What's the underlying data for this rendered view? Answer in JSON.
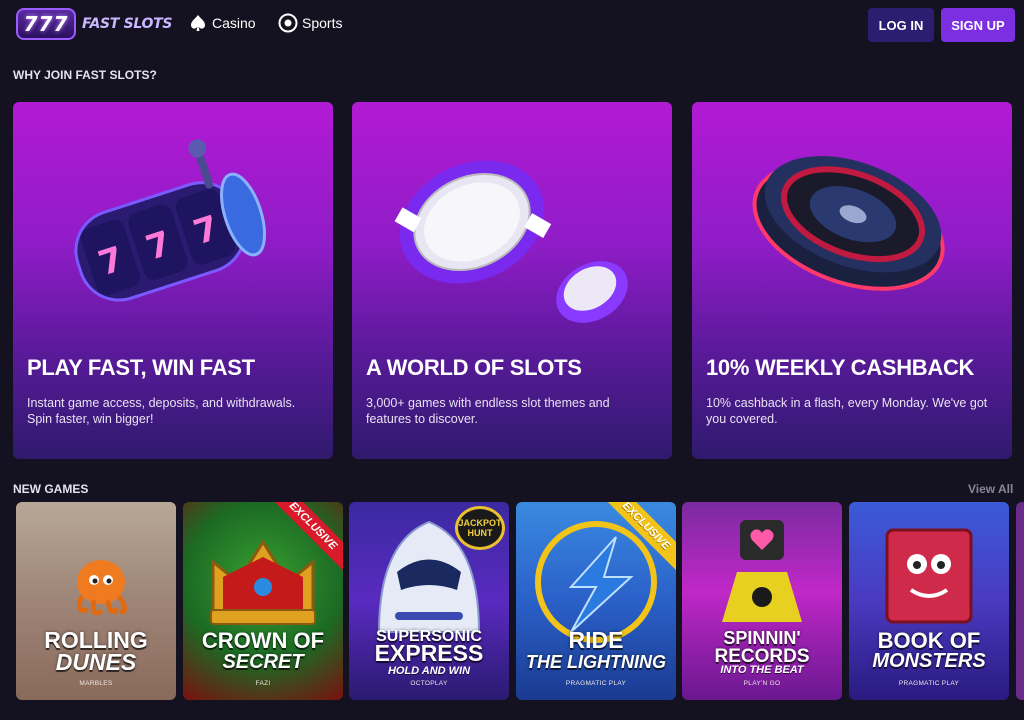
{
  "header": {
    "logo_badge": "777",
    "logo_text": "FAST SLOTS",
    "nav": [
      {
        "label": "Casino",
        "icon": "spade-icon"
      },
      {
        "label": "Sports",
        "icon": "football-icon"
      }
    ],
    "login_label": "LOG IN",
    "signup_label": "SIGN UP"
  },
  "why_section": {
    "title": "WHY JOIN FAST SLOTS?",
    "cards": [
      {
        "title": "PLAY FAST, WIN FAST",
        "text": "Instant game access, deposits, and withdrawals. Spin faster, win bigger!",
        "icon": "slot-reels-icon"
      },
      {
        "title": "A WORLD OF SLOTS",
        "text": "3,000+ games with endless slot themes and features to discover.",
        "icon": "casino-chips-icon"
      },
      {
        "title": "10% WEEKLY CASHBACK",
        "text": "10% cashback in a flash, every Monday. We've got you covered.",
        "icon": "roulette-wheel-icon"
      }
    ]
  },
  "new_games": {
    "title": "NEW GAMES",
    "view_all": "View All",
    "games": [
      {
        "title_1": "ROLLING",
        "title_2": "DUNES",
        "sub": "",
        "provider": "MARBLES",
        "ribbon": ""
      },
      {
        "title_1": "CROWN OF",
        "title_2": "SECRET",
        "sub": "",
        "provider": "FAZI",
        "ribbon": "EXCLUSIVE"
      },
      {
        "title_1": "SUPERSONIC",
        "title_2": "EXPRESS",
        "sub": "HOLD AND WIN",
        "provider": "OCTOPLAY",
        "badge": "JACKPOT HUNT"
      },
      {
        "title_1": "RIDE",
        "title_2": "THE LIGHTNING",
        "sub": "",
        "provider": "PRAGMATIC PLAY",
        "ribbon": "EXCLUSIVE"
      },
      {
        "title_1": "SPINNIN'",
        "title_2": "RECORDS",
        "sub": "INTO THE BEAT",
        "provider": "PLAY'N GO",
        "ribbon": ""
      },
      {
        "title_1": "BOOK OF",
        "title_2": "MONSTERS",
        "sub": "",
        "provider": "PRAGMATIC PLAY",
        "ribbon": ""
      }
    ]
  }
}
